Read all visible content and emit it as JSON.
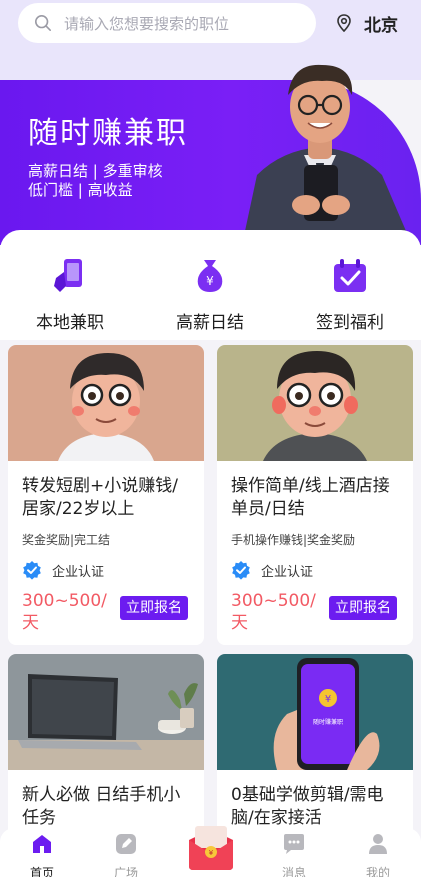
{
  "search": {
    "placeholder": "请输入您想要搜索的职位"
  },
  "location": {
    "city": "北京"
  },
  "banner": {
    "title": "随时赚兼职",
    "line1": "高薪日结 | 多重审核",
    "line2": "低门槛 | 高收益"
  },
  "features": [
    {
      "label": "本地兼职",
      "icon": "hand-phone-icon"
    },
    {
      "label": "高薪日结",
      "icon": "money-bag-icon"
    },
    {
      "label": "签到福利",
      "icon": "calendar-check-icon"
    }
  ],
  "jobs": [
    {
      "title": "转发短剧+小说赚钱/居家/22岁以上",
      "tags": "奖金奖励|完工结",
      "cert": "企业认证",
      "pay": "300~500/天",
      "apply": "立即报名"
    },
    {
      "title": "操作简单/线上酒店接单员/日结",
      "tags": "手机操作赚钱|奖金奖励",
      "cert": "企业认证",
      "pay": "300~500/天",
      "apply": "立即报名"
    },
    {
      "title": "新人必做 日结手机小任务",
      "phone_text": ""
    },
    {
      "title": "0基础学做剪辑/需电脑/在家接活",
      "phone_text": "随时赚兼职"
    }
  ],
  "tabbar": [
    {
      "label": "首页",
      "icon": "home-icon",
      "active": true
    },
    {
      "label": "广场",
      "icon": "edit-icon",
      "active": false
    },
    {
      "label": "消息",
      "icon": "message-icon",
      "active": false
    },
    {
      "label": "我的",
      "icon": "user-icon",
      "active": false
    }
  ],
  "colors": {
    "primary": "#6c1cf0",
    "price": "#f25a64",
    "verified": "#2a8cf7"
  }
}
